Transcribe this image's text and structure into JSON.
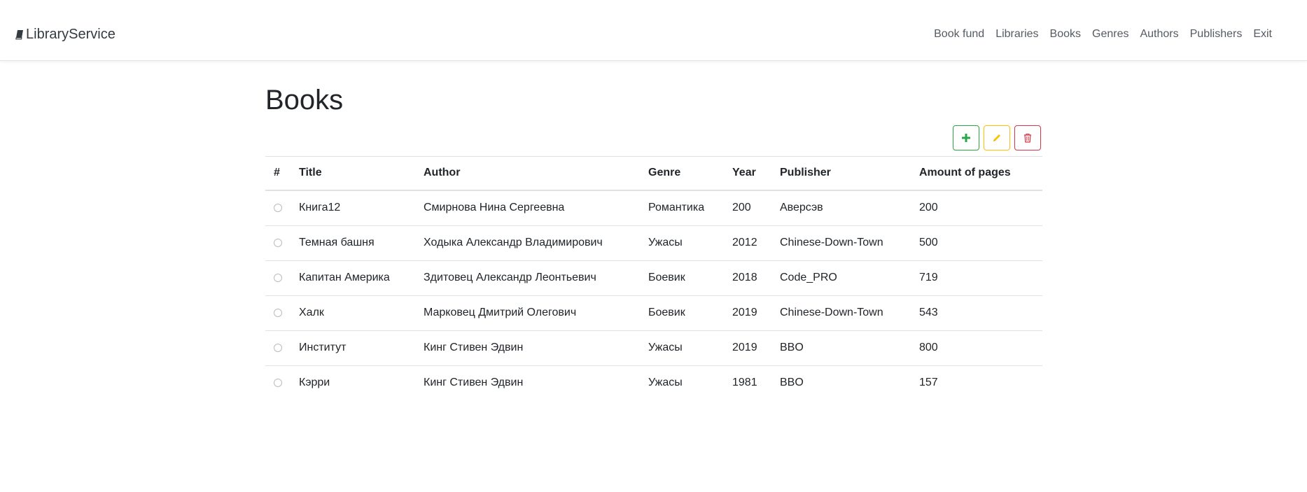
{
  "brand": {
    "name": "LibraryService",
    "icon": "book-icon"
  },
  "nav": {
    "items": [
      {
        "label": "Book fund"
      },
      {
        "label": "Libraries"
      },
      {
        "label": "Books"
      },
      {
        "label": "Genres"
      },
      {
        "label": "Authors"
      },
      {
        "label": "Publishers"
      },
      {
        "label": "Exit"
      }
    ]
  },
  "page": {
    "title": "Books"
  },
  "toolbar": {
    "add_icon": "plus-icon",
    "edit_icon": "pencil-icon",
    "delete_icon": "trash-icon",
    "colors": {
      "add": "#28a745",
      "edit": "#ffc107",
      "delete": "#dc3545"
    }
  },
  "table": {
    "headers": {
      "num": "#",
      "title": "Title",
      "author": "Author",
      "genre": "Genre",
      "year": "Year",
      "publisher": "Publisher",
      "pages": "Amount of pages"
    },
    "rows": [
      {
        "title": "Книга12",
        "author": "Смирнова Нина Сергеевна",
        "genre": "Романтика",
        "year": "200",
        "publisher": "Аверсэв",
        "pages": "200"
      },
      {
        "title": "Темная башня",
        "author": "Ходыка Александр Владимирович",
        "genre": "Ужасы",
        "year": "2012",
        "publisher": "Chinese-Down-Town",
        "pages": "500"
      },
      {
        "title": "Капитан Америка",
        "author": "Здитовец Александр Леонтьевич",
        "genre": "Боевик",
        "year": "2018",
        "publisher": "Code_PRO",
        "pages": "719"
      },
      {
        "title": "Халк",
        "author": "Марковец Дмитрий Олегович",
        "genre": "Боевик",
        "year": "2019",
        "publisher": "Chinese-Down-Town",
        "pages": "543"
      },
      {
        "title": "Институт",
        "author": "Кинг Стивен Эдвин",
        "genre": "Ужасы",
        "year": "2019",
        "publisher": "BBO",
        "pages": "800"
      },
      {
        "title": "Кэрри",
        "author": "Кинг Стивен Эдвин",
        "genre": "Ужасы",
        "year": "1981",
        "publisher": "BBO",
        "pages": "157"
      }
    ]
  }
}
